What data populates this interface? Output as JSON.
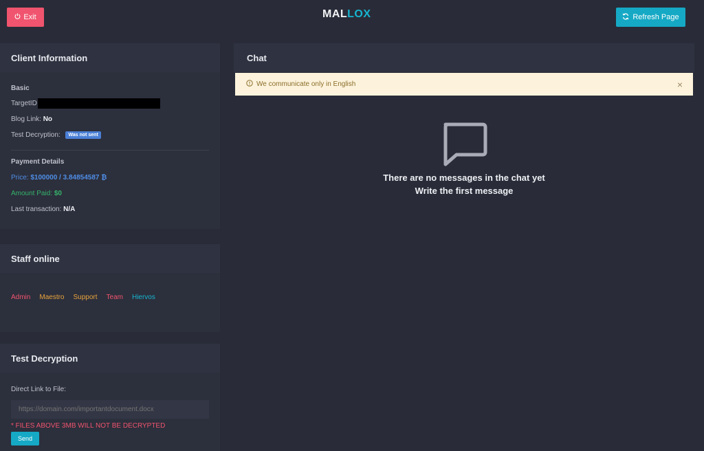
{
  "header": {
    "exit_label": "Exit",
    "logo_main": "MAL",
    "logo_accent": "LOX",
    "refresh_label": "Refresh Page"
  },
  "client_info": {
    "title": "Client Information",
    "basic_title": "Basic",
    "target_label": "TargetID",
    "blog_label": "Blog Link:",
    "blog_value": "No",
    "test_label": "Test Decryption:",
    "test_badge": "Was not sent",
    "payment_title": "Payment Details",
    "price_label": "Price:",
    "price_value": "$100000 / 3.84854587 ₿",
    "paid_label": "Amount Paid:",
    "paid_value": "$0",
    "last_label": "Last transaction:",
    "last_value": "N/A"
  },
  "staff": {
    "title": "Staff online",
    "members": [
      {
        "name": "Admin",
        "color": "#f0546e"
      },
      {
        "name": "Maestro",
        "color": "#e8a33c"
      },
      {
        "name": "Support",
        "color": "#e8a33c"
      },
      {
        "name": "Team",
        "color": "#f0546e"
      },
      {
        "name": "Hiervos",
        "color": "#17b5d0"
      }
    ]
  },
  "test_decryption": {
    "title": "Test Decryption",
    "link_label": "Direct Link to File:",
    "link_placeholder": "https://domain.com/importantdocument.docx",
    "warning": "* FILES ABOVE 3MB WILL NOT BE DECRYPTED",
    "send_label": "Send"
  },
  "chat": {
    "title": "Chat",
    "notice": "We communicate only in English",
    "close_glyph": "×",
    "empty_line1": "There are no messages in the chat yet",
    "empty_line2": "Write the first message"
  },
  "icons": {
    "exit": "power-icon",
    "refresh": "refresh-icon",
    "notice": "info-icon",
    "chat_empty": "chat-bubble-icon"
  }
}
